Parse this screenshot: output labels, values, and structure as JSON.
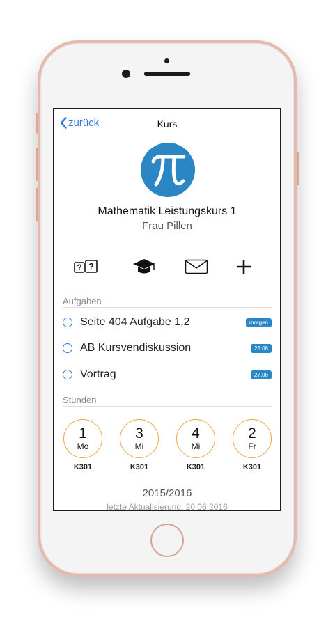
{
  "nav": {
    "back_label": "zurück",
    "title": "Kurs"
  },
  "course": {
    "icon": "pi-icon",
    "icon_color": "#2b86c6",
    "title": "Mathematik Leistungskurs 1",
    "teacher": "Frau Pillen"
  },
  "actions": [
    {
      "icon": "flashcards-icon"
    },
    {
      "icon": "graduation-cap-icon"
    },
    {
      "icon": "mail-icon"
    },
    {
      "icon": "plus-icon"
    }
  ],
  "tasks_section": {
    "label": "Aufgaben",
    "items": [
      {
        "title": "Seite 404 Aufgabe 1,2",
        "badge": "morgen"
      },
      {
        "title": "AB Kursvendiskussion",
        "badge": "25.06"
      },
      {
        "title": "Vortrag",
        "badge": "27.06"
      }
    ]
  },
  "lessons_section": {
    "label": "Stunden",
    "items": [
      {
        "number": "1",
        "day": "Mo",
        "room": "K301"
      },
      {
        "number": "3",
        "day": "Mi",
        "room": "K301"
      },
      {
        "number": "4",
        "day": "Mi",
        "room": "K301"
      },
      {
        "number": "2",
        "day": "Fr",
        "room": "K301"
      }
    ]
  },
  "footer": {
    "school_year": "2015/2016",
    "last_update": "letzte Aktualisierung: 20.06.2016"
  },
  "colors": {
    "accent": "#2a7de1",
    "badge": "#2b86c6",
    "lesson_ring": "#f0a64a",
    "phone_frame": "#e7b9ad"
  }
}
